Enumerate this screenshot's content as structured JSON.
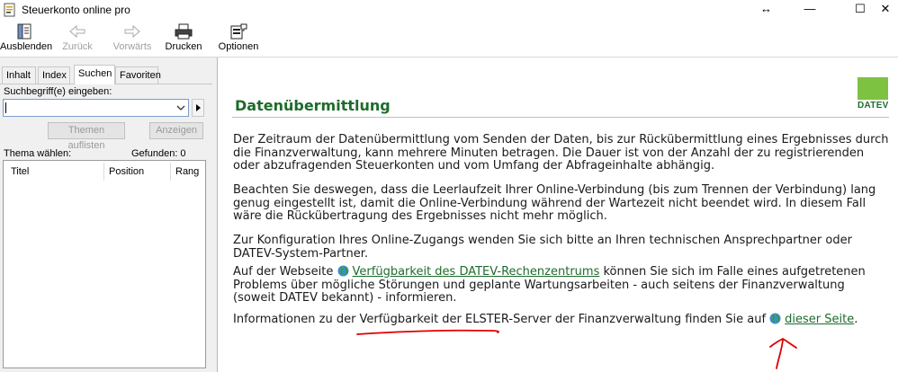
{
  "window": {
    "title": "Steuerkonto online pro",
    "resize_glyph": "↔",
    "minimize_glyph": "—",
    "maximize_glyph": "☐",
    "close_glyph": "✕"
  },
  "toolbar": {
    "hide_label": "Ausblenden",
    "back_label": "Zurück",
    "forward_label": "Vorwärts",
    "print_label": "Drucken",
    "options_label": "Optionen"
  },
  "sidebar": {
    "tabs": [
      "Inhalt",
      "Index",
      "Suchen",
      "Favoriten"
    ],
    "active_tab": "Suchen",
    "search_label": "Suchbegriff(e) eingeben:",
    "search_value": "",
    "list_topics_button": "Themen auflisten",
    "show_button": "Anzeigen",
    "choose_topic_label": "Thema wählen:",
    "found_label": "Gefunden: 0",
    "columns": [
      "Titel",
      "Position",
      "Rang"
    ]
  },
  "content": {
    "logo_text": "DATEV",
    "heading": "Datenübermittlung",
    "para1": "Der Zeitraum der Datenübermittlung vom Senden der Daten, bis zur Rückübermittlung eines Ergebnisses durch die Finanzverwaltung, kann mehrere Minuten betragen. Die Dauer ist von der Anzahl der zu registrierenden oder abzufragenden Steuerkonten und vom Umfang der Abfrageinhalte abhängig.",
    "para2": "Beachten Sie deswegen, dass die Leerlaufzeit Ihrer Online-Verbindung (bis zum Trennen der Verbindung) lang genug eingestellt ist, damit die Online-Verbindung während der Wartezeit nicht beendet wird. In diesem Fall wäre die Rückübertragung des Ergebnisses nicht mehr möglich.",
    "para3": "Zur Konfiguration Ihres Online-Zugangs wenden Sie sich bitte an Ihren technischen Ansprechpartner oder DATEV-System-Partner.",
    "para4_before": "Auf der Webseite",
    "para4_link": "Verfügbarkeit des DATEV-Rechenzentrums",
    "para4_after": "können Sie sich im Falle eines aufgetretenen Problems über mögliche Störungen und geplante Wartungsarbeiten - auch seitens der Finanzverwaltung (soweit DATEV bekannt) - informieren.",
    "para5_before": "Informationen zu der Verfügbarkeit der ELSTER-Server der Finanzverwaltung finden Sie auf",
    "para5_link": "dieser Seite",
    "para5_after": "."
  },
  "colors": {
    "heading_green": "#1e6b2c",
    "logo_green": "#7ec242",
    "annotation_red": "#e00000"
  },
  "icons": [
    "app-icon",
    "hide-icon",
    "back-arrow-icon",
    "forward-arrow-icon",
    "printer-icon",
    "options-icon",
    "globe-icon",
    "dropdown-chevron-icon"
  ]
}
